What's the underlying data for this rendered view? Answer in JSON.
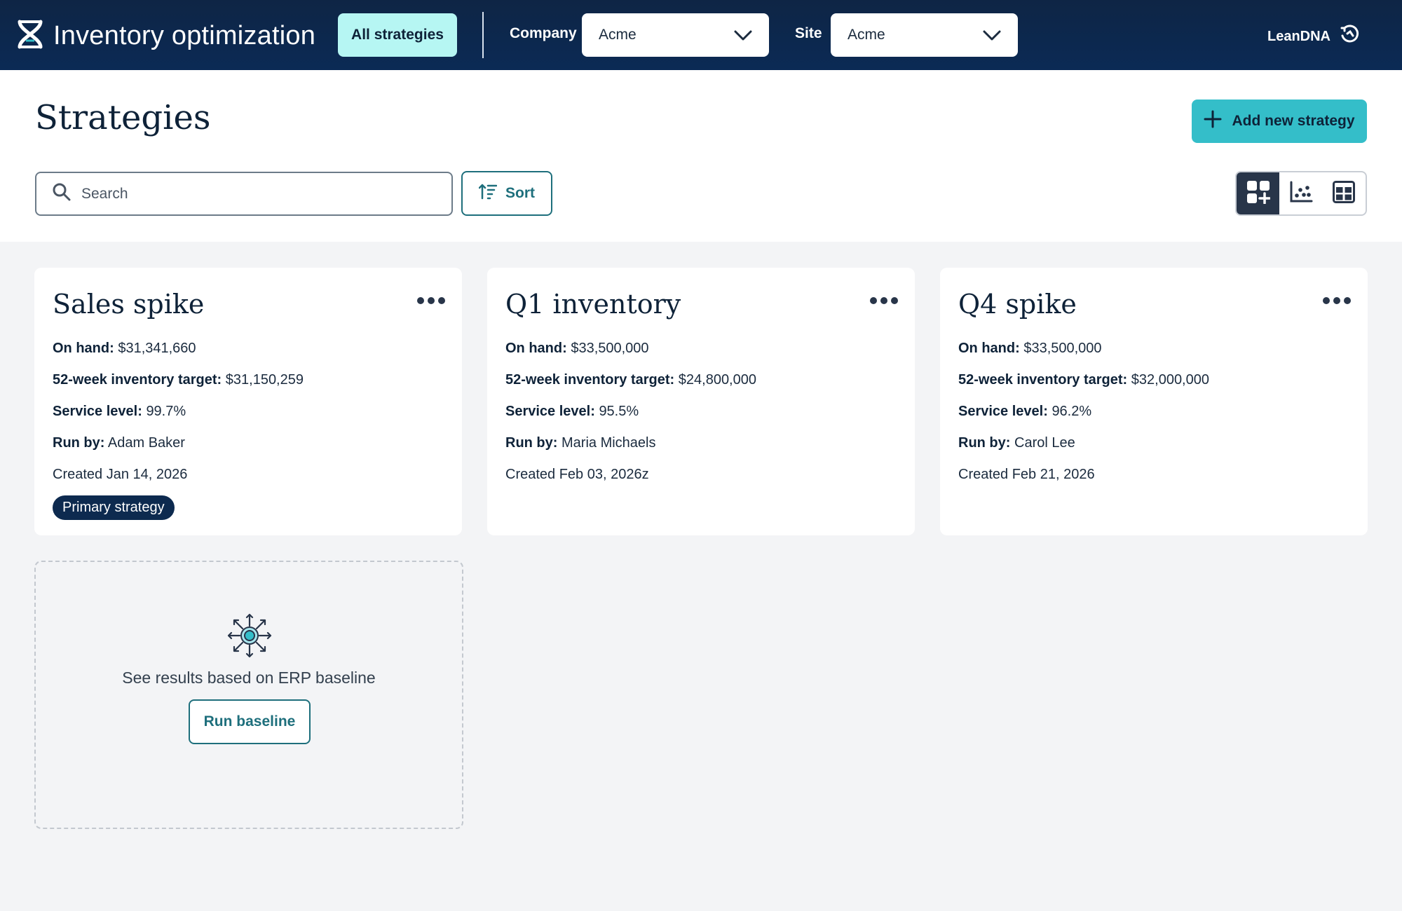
{
  "app": {
    "title": "Inventory optimization",
    "nav_tab": "All strategies",
    "company_label": "Company",
    "company_value": "Acme",
    "site_label": "Site",
    "site_value": "Acme",
    "account_label": "LeanDNA",
    "colors": {
      "topbar": "#0b2a55",
      "accent": "#34bec9",
      "tab_active": "#b6f6f3",
      "badge": "#0d2a4f",
      "teal_text": "#1e6f7c"
    }
  },
  "page": {
    "title": "Strategies",
    "add_button": "Add new strategy",
    "search_placeholder": "Search",
    "search_value": "",
    "sort_label": "Sort",
    "view_modes": [
      {
        "name": "grid-add",
        "active": true
      },
      {
        "name": "scatter",
        "active": false
      },
      {
        "name": "table",
        "active": false
      }
    ]
  },
  "labels": {
    "on_hand": "On hand:",
    "target": "52-week inventory target:",
    "service": "Service level:",
    "run_by": "Run by:"
  },
  "strategies": [
    {
      "name": "Sales spike",
      "on_hand": "$31,341,660",
      "target": "$31,150,259",
      "service_level": "99.7%",
      "run_by": "Adam Baker",
      "created": "Created Jan 14, 2026",
      "badge": "Primary strategy"
    },
    {
      "name": "Q1 inventory",
      "on_hand": "$33,500,000",
      "target": "$24,800,000",
      "service_level": "95.5%",
      "run_by": "Maria Michaels",
      "created": "Created Feb 03, 2026z"
    },
    {
      "name": "Q4 spike",
      "on_hand": "$33,500,000",
      "target": "$32,000,000",
      "service_level": "96.2%",
      "run_by": "Carol Lee",
      "created": "Created Feb 21, 2026"
    }
  ],
  "baseline": {
    "text": "See results based on ERP baseline",
    "button": "Run baseline",
    "icon": "expand-hub-icon"
  }
}
